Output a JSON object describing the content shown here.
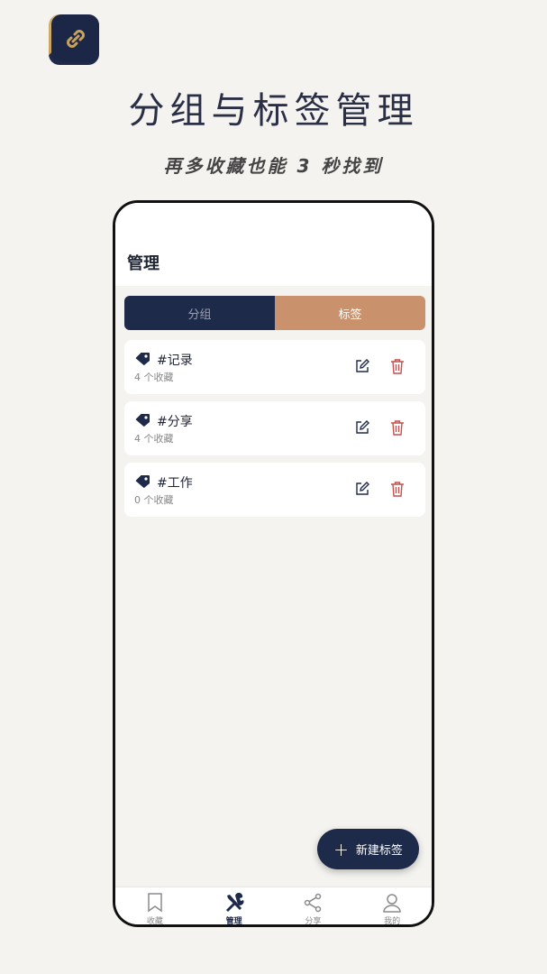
{
  "headline": "分组与标签管理",
  "subline": "再多收藏也能 3 秒找到",
  "screen": {
    "title": "管理",
    "segments": [
      {
        "label": "分组",
        "active": false
      },
      {
        "label": "标签",
        "active": true
      }
    ],
    "tags": [
      {
        "name": "#记录",
        "count": "4 个收藏"
      },
      {
        "name": "#分享",
        "count": "4 个收藏"
      },
      {
        "name": "#工作",
        "count": "0 个收藏"
      }
    ],
    "fab_label": "新建标签",
    "nav": [
      {
        "label": "收藏",
        "icon": "bookmark-icon"
      },
      {
        "label": "管理",
        "icon": "tools-icon",
        "active": true
      },
      {
        "label": "分享",
        "icon": "share-icon"
      },
      {
        "label": "我的",
        "icon": "user-icon"
      }
    ]
  },
  "colors": {
    "navy": "#1e2a4a",
    "accent": "#c9916c",
    "delete": "#c0524f",
    "background": "#f4f3ef"
  }
}
